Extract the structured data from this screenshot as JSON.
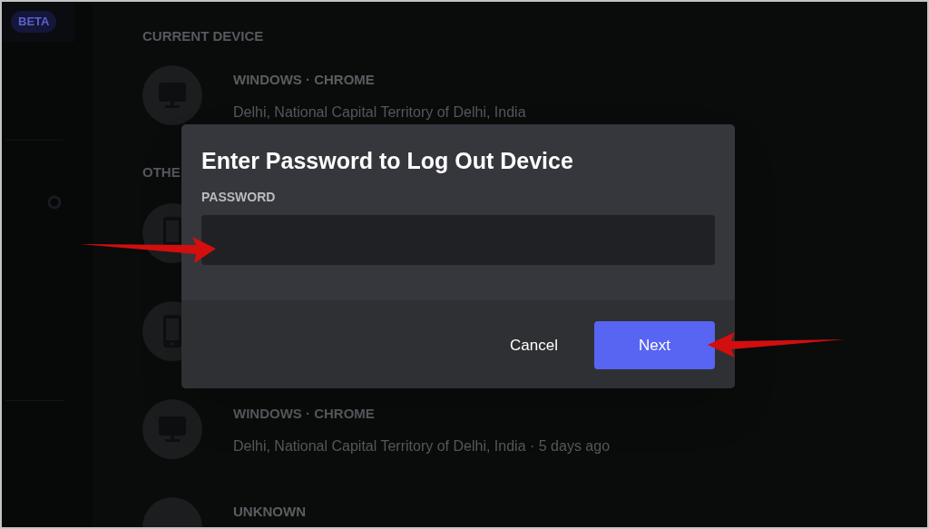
{
  "sidebar": {
    "badge": "BETA"
  },
  "devices": {
    "current_heading": "CURRENT DEVICE",
    "current": [
      {
        "kind": "desktop",
        "platform": "WINDOWS · CHROME",
        "location": "Delhi, National Capital Territory of Delhi, India"
      }
    ],
    "other_heading": "OTHE",
    "other": [
      {
        "kind": "phone"
      },
      {
        "kind": "phone"
      },
      {
        "kind": "desktop",
        "platform": "WINDOWS · CHROME",
        "location": "Delhi, National Capital Territory of Delhi, India · 5 days ago"
      },
      {
        "kind": "unknown",
        "platform": "UNKNOWN"
      }
    ]
  },
  "dialog": {
    "title": "Enter Password to Log Out Device",
    "field_label": "PASSWORD",
    "buttons": [
      {
        "kind": "link",
        "label": "Cancel"
      },
      {
        "kind": "primary",
        "label": "Next"
      }
    ]
  }
}
